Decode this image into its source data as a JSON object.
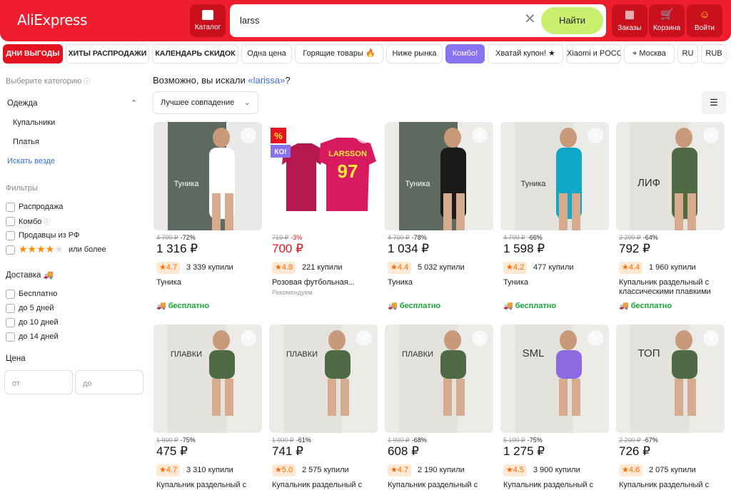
{
  "header": {
    "logo": "AliExpress",
    "catalog_label": "Каталог",
    "search_value": "larss",
    "find_label": "Найти",
    "orders_label": "Заказы",
    "cart_label": "Корзина",
    "login_label": "Войти"
  },
  "chips": [
    "ДНИ ВЫГОДЫ",
    "ХИТЫ РАСПРОДАЖИ",
    "КАЛЕНДАРЬ СКИДОК",
    "Одна цена",
    "Горящие товары 🔥",
    "Ниже рынка",
    "Комбо!",
    "Хватай купон! ★",
    "Xiaomi и POCO",
    "Москва",
    "RU",
    "RUB"
  ],
  "sidebar": {
    "choose_category": "Выберите категорию",
    "category": "Одежда",
    "subcategories": [
      "Купальники",
      "Платья"
    ],
    "search_everywhere": "Искать везде",
    "filters_title": "Фильтры",
    "filters": [
      "Распродажа",
      "Комбо",
      "Продавцы из РФ",
      "или более"
    ],
    "delivery_title": "Доставка",
    "delivery": [
      "Бесплатно",
      "до 5 дней",
      "до 10 дней",
      "до 14 дней"
    ],
    "price_title": "Цена",
    "price_from": "от",
    "price_to": "до"
  },
  "hint": {
    "prefix": "Возможно, вы искали ",
    "suggestion": "«larissa»",
    "suffix": "?"
  },
  "sort_label": "Лучшее совпадение",
  "products": [
    {
      "old": "4 700 ₽",
      "disc": "-72%",
      "price": "1 316 ₽",
      "rating": "4.7",
      "sold": "3 339 купили",
      "title": "Туника",
      "sub": "",
      "free": "бесплатно",
      "bg": "#e9e9e7",
      "tone": "#ffffff"
    },
    {
      "old": "719 ₽",
      "disc": "-3%",
      "price": "700 ₽",
      "rating": "4.8",
      "sold": "221 купили",
      "title": "Розовая футбольная...",
      "sub": "Рекомендуем",
      "free": "",
      "bg": "#ffffff",
      "tone": "#c2185b"
    },
    {
      "old": "4 700 ₽",
      "disc": "-78%",
      "price": "1 034 ₽",
      "rating": "4.4",
      "sold": "5 032 купили",
      "title": "Туника",
      "sub": "",
      "free": "бесплатно",
      "bg": "#ecebe8",
      "tone": "#1a1a1a"
    },
    {
      "old": "4 700 ₽",
      "disc": "-66%",
      "price": "1 598 ₽",
      "rating": "4.2",
      "sold": "477 купили",
      "title": "Туника",
      "sub": "",
      "free": "бесплатно",
      "bg": "#ecebe8",
      "tone": "#10a8c8"
    },
    {
      "old": "2 200 ₽",
      "disc": "-64%",
      "price": "792 ₽",
      "rating": "4.4",
      "sold": "1 960 купили",
      "title": "Купальник раздельный с классическими плавкими",
      "sub": "",
      "free": "бесплатно",
      "bg": "#ecebe8",
      "tone": "#4f6b46"
    },
    {
      "old": "1 900 ₽",
      "disc": "-75%",
      "price": "475 ₽",
      "rating": "4.7",
      "sold": "3 310 купили",
      "title": "Купальник раздельный с",
      "sub": "",
      "free": "",
      "bg": "#ecebe8",
      "tone": "#4f6b46"
    },
    {
      "old": "1 900 ₽",
      "disc": "-61%",
      "price": "741 ₽",
      "rating": "5.0",
      "sold": "2 575 купили",
      "title": "Купальник раздельный с",
      "sub": "",
      "free": "",
      "bg": "#ecebe8",
      "tone": "#4f6b46"
    },
    {
      "old": "1 900 ₽",
      "disc": "-68%",
      "price": "608 ₽",
      "rating": "4.7",
      "sold": "2 190 купили",
      "title": "Купальник раздельный с",
      "sub": "",
      "free": "",
      "bg": "#ecebe8",
      "tone": "#4f6b46"
    },
    {
      "old": "5 100 ₽",
      "disc": "-75%",
      "price": "1 275 ₽",
      "rating": "4.5",
      "sold": "3 900 купили",
      "title": "Купальник раздельный с",
      "sub": "",
      "free": "",
      "bg": "#ecebe8",
      "tone": "#8c6be0"
    },
    {
      "old": "2 200 ₽",
      "disc": "-67%",
      "price": "726 ₽",
      "rating": "4.6",
      "sold": "2 075 купили",
      "title": "Купальник раздельный с",
      "sub": "",
      "free": "",
      "bg": "#ecebe8",
      "tone": "#4f6b46"
    }
  ],
  "image_labels": [
    "Туника",
    "LARSSON 97",
    "Туника",
    "Туника",
    "ЛИФ",
    "ПЛАВКИ",
    "ПЛАВКИ",
    "ПЛАВКИ",
    "SML",
    "ТОП"
  ],
  "colors": {
    "brand": "#ee1e2e",
    "accent": "#c8f06e",
    "combo": "#8a73f0",
    "free": "#17a639",
    "rating_bg": "#ffe9d4"
  }
}
